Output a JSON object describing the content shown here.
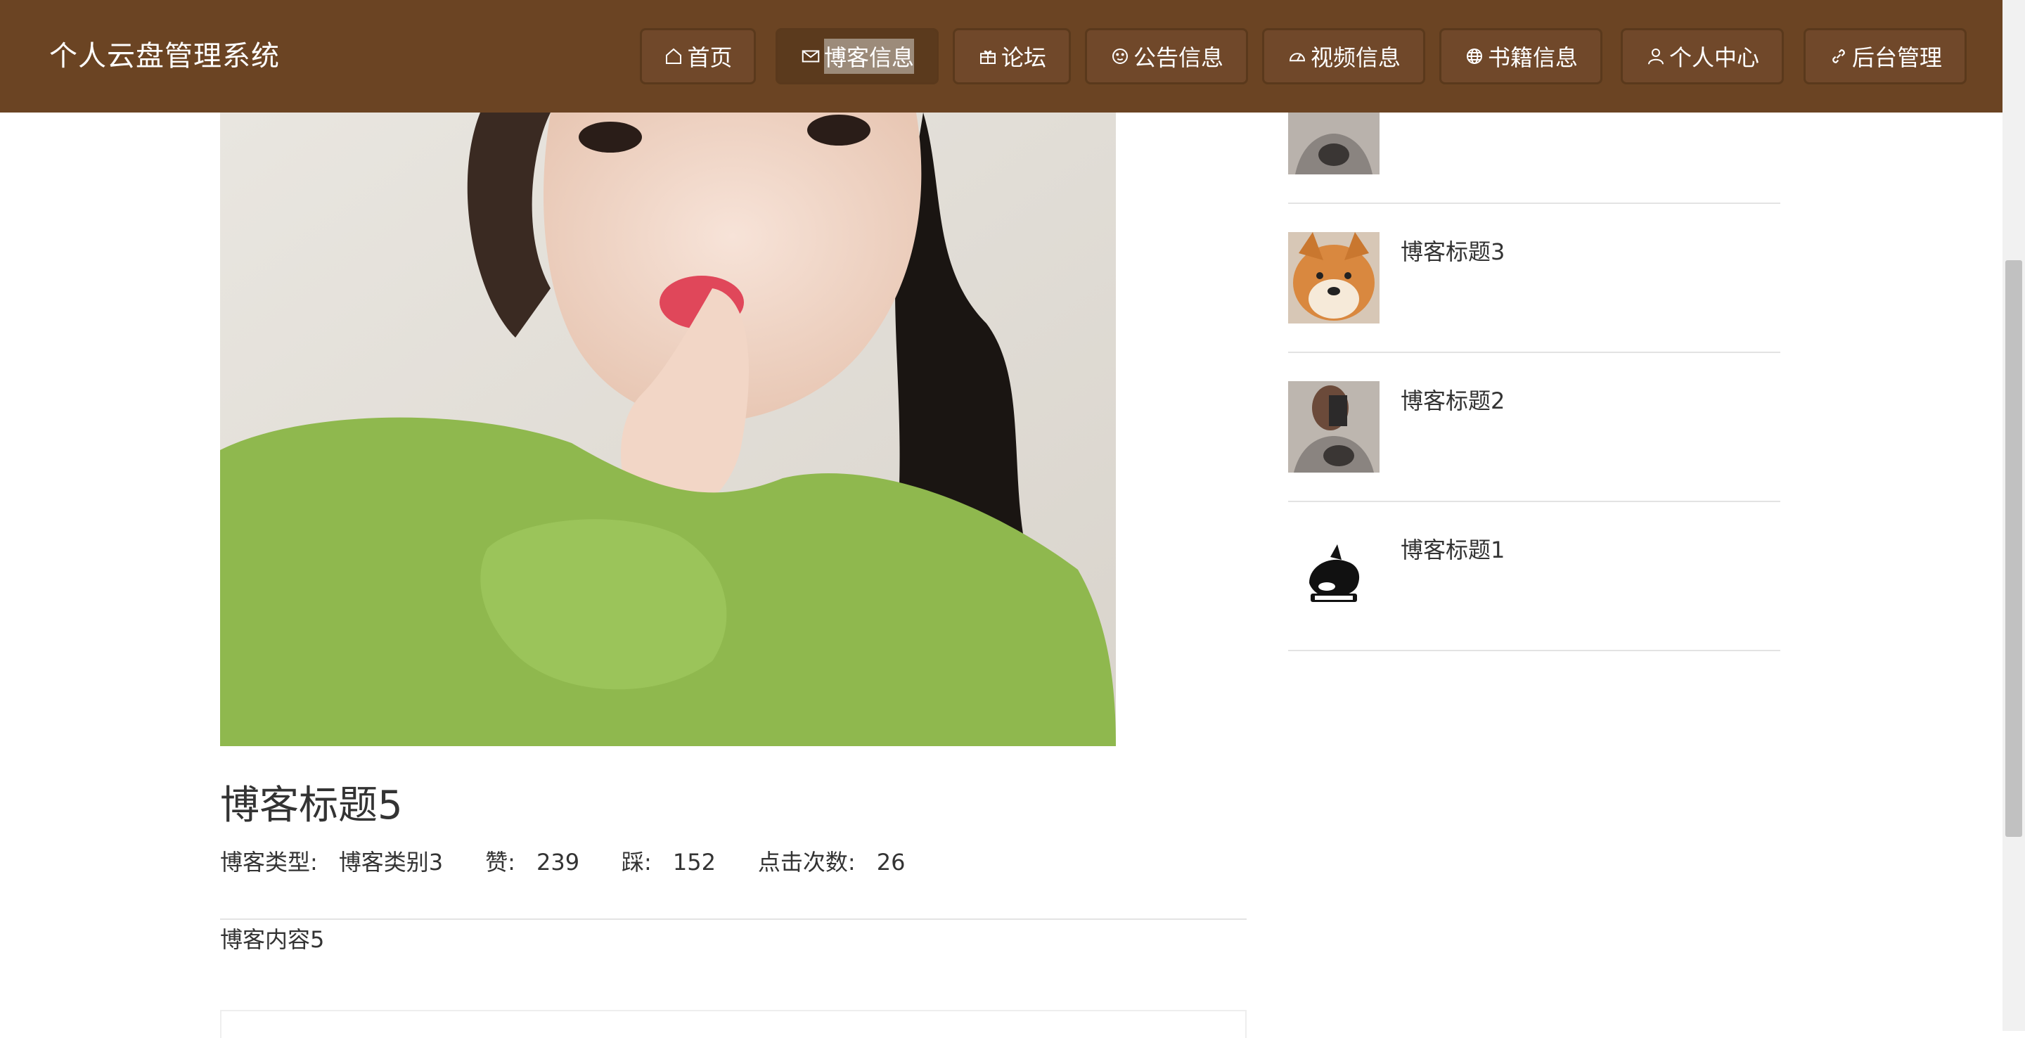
{
  "header": {
    "brand": "个人云盘管理系统",
    "nav": [
      {
        "label": "首页",
        "icon": "home-icon",
        "active": false
      },
      {
        "label": "博客信息",
        "icon": "mail-icon",
        "active": true
      },
      {
        "label": "论坛",
        "icon": "gift-icon",
        "active": false
      },
      {
        "label": "公告信息",
        "icon": "smile-icon",
        "active": false
      },
      {
        "label": "视频信息",
        "icon": "dashboard-icon",
        "active": false
      },
      {
        "label": "书籍信息",
        "icon": "globe-icon",
        "active": false
      },
      {
        "label": "个人中心",
        "icon": "user-icon",
        "active": false
      },
      {
        "label": "后台管理",
        "icon": "link-icon",
        "active": false
      }
    ]
  },
  "post": {
    "title": "博客标题5",
    "type_label": "博客类型:",
    "type_value": "博客类别3",
    "like_label": "赞:",
    "like_value": "239",
    "dislike_label": "踩:",
    "dislike_value": "152",
    "clicks_label": "点击次数:",
    "clicks_value": "26",
    "content": "博客内容5"
  },
  "sidebar": {
    "items": [
      {
        "title": "",
        "thumb": "man-mirror-selfie"
      },
      {
        "title": "博客标题3",
        "thumb": "shiba-dog"
      },
      {
        "title": "博客标题2",
        "thumb": "man-mirror-selfie"
      },
      {
        "title": "博客标题1",
        "thumb": "orca-logo"
      }
    ]
  },
  "colors": {
    "header_bg": "#6b4423",
    "active_nav": "#5b3a1d",
    "text": "#333333"
  }
}
